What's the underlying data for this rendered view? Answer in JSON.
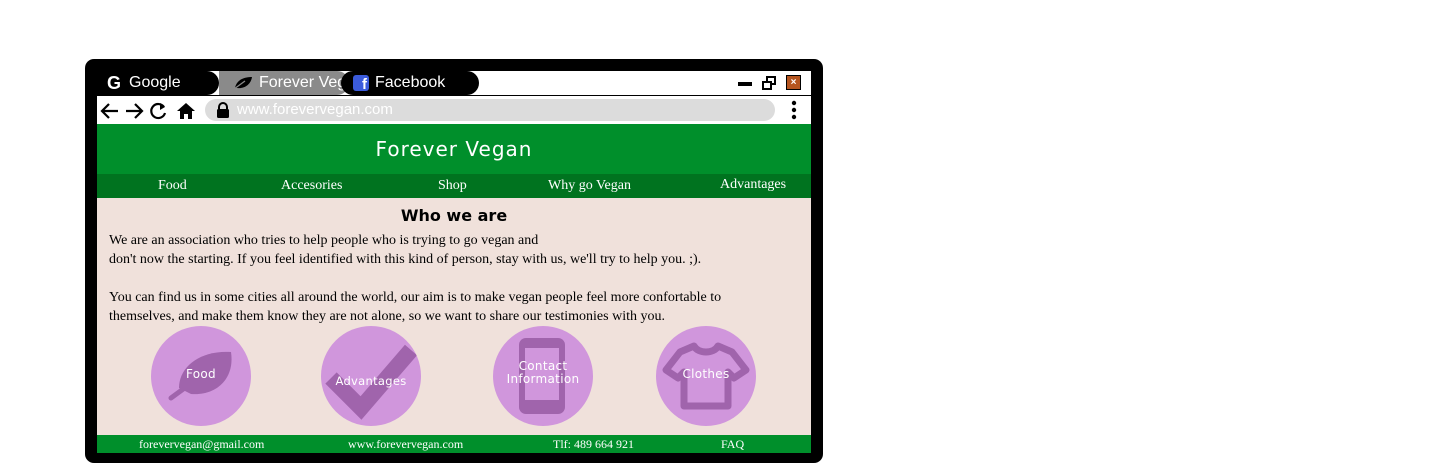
{
  "browser": {
    "tabs": [
      {
        "label": "Google",
        "icon": "google-g-icon"
      },
      {
        "label": "Forever Veg",
        "icon": "leaf-icon"
      },
      {
        "label": "Facebook",
        "icon": "facebook-icon"
      }
    ],
    "url": "www.forevervegan.com"
  },
  "site": {
    "title": "Forever Vegan",
    "nav": [
      "Food",
      "Accesories",
      "Shop",
      "Why go Vegan",
      "Advantages"
    ],
    "section_title": "Who we are",
    "paragraphs": [
      [
        "We are an association who tries to help people who is trying to go vegan and",
        "don't now the starting. If you feel identified with this kind of person, stay with us, we'll try to help you. ;)."
      ],
      [
        "You can find us in some cities all around the world, our aim is to make vegan people feel more confortable to",
        "themselves, and make them know they are not alone, so we want to share our testimonies with you."
      ]
    ],
    "circles": [
      {
        "label": "Food",
        "icon": "leaf-icon"
      },
      {
        "label": "Advantages",
        "icon": "checkmark-icon"
      },
      {
        "label_lines": [
          "Contact",
          "Information"
        ],
        "icon": "phone-icon"
      },
      {
        "label": "Clothes",
        "icon": "tshirt-icon"
      }
    ],
    "footer": [
      "forevervegan@gmail.com",
      "www.forevervegan.com",
      "Tlf: 489 664 921",
      "FAQ"
    ]
  },
  "colors": {
    "header_green": "#008f2b",
    "nav_green": "#00731f",
    "page_bg": "#f0e1db",
    "circle_purple": "#d096dc"
  }
}
